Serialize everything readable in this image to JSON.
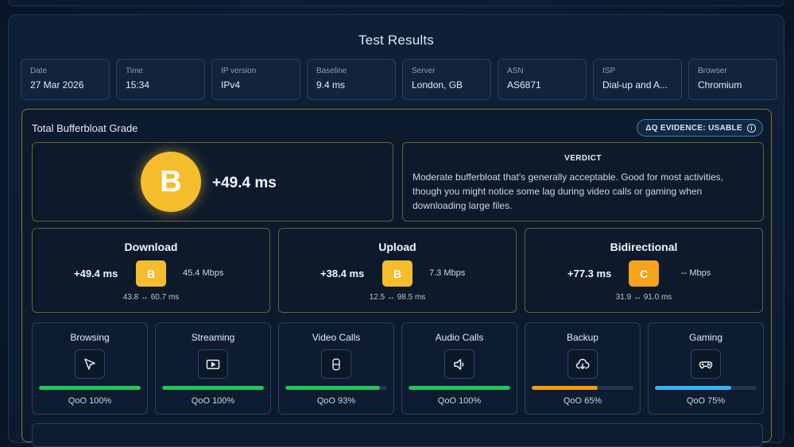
{
  "title": "Test Results",
  "meta": [
    {
      "label": "Date",
      "value": "27 Mar 2026"
    },
    {
      "label": "Time",
      "value": "15:34"
    },
    {
      "label": "IP version",
      "value": "IPv4"
    },
    {
      "label": "Baseline",
      "value": "9.4 ms"
    },
    {
      "label": "Server",
      "value": "London, GB"
    },
    {
      "label": "ASN",
      "value": "AS6871"
    },
    {
      "label": "ISP",
      "value": "Dial-up and A..."
    },
    {
      "label": "Browser",
      "value": "Chromium"
    }
  ],
  "grade_panel": {
    "title": "Total Bufferbloat Grade",
    "evidence": "ΔQ EVIDENCE: USABLE",
    "grade": "B",
    "grade_color": "#f5bd2c",
    "delta": "+49.4 ms",
    "verdict_label": "VERDICT",
    "verdict_text": "Moderate bufferbloat that's generally acceptable. Good for most activities, though you might notice some lag during video calls or gaming when downloading large files."
  },
  "directions": [
    {
      "title": "Download",
      "delta": "+49.4 ms",
      "grade": "B",
      "grade_color": "#f5bd2c",
      "speed": "45.4 Mbps",
      "range": "43.8 ↔ 60.7 ms"
    },
    {
      "title": "Upload",
      "delta": "+38.4 ms",
      "grade": "B",
      "grade_color": "#f5bd2c",
      "speed": "7.3 Mbps",
      "range": "12.5 ↔ 98.5 ms"
    },
    {
      "title": "Bidirectional",
      "delta": "+77.3 ms",
      "grade": "C",
      "grade_color": "#f5a21c",
      "speed": "-- Mbps",
      "range": "31.9 ↔ 91.0 ms"
    }
  ],
  "use_cases": [
    {
      "title": "Browsing",
      "icon": "cursor-icon",
      "qoo_label": "QoO 100%",
      "qoo": 1.0,
      "color": "#22c55e"
    },
    {
      "title": "Streaming",
      "icon": "video-icon",
      "qoo_label": "QoO 100%",
      "qoo": 1.0,
      "color": "#22c55e"
    },
    {
      "title": "Video Calls",
      "icon": "phone-icon",
      "qoo_label": "QoO 93%",
      "qoo": 0.93,
      "color": "#22c55e"
    },
    {
      "title": "Audio Calls",
      "icon": "speaker-icon",
      "qoo_label": "QoO 100%",
      "qoo": 1.0,
      "color": "#22c55e"
    },
    {
      "title": "Backup",
      "icon": "cloud-download-icon",
      "qoo_label": "QoO 65%",
      "qoo": 0.65,
      "color": "#f59e0b"
    },
    {
      "title": "Gaming",
      "icon": "gamepad-icon",
      "qoo_label": "QoO 75%",
      "qoo": 0.75,
      "color": "#38b2f5"
    }
  ]
}
